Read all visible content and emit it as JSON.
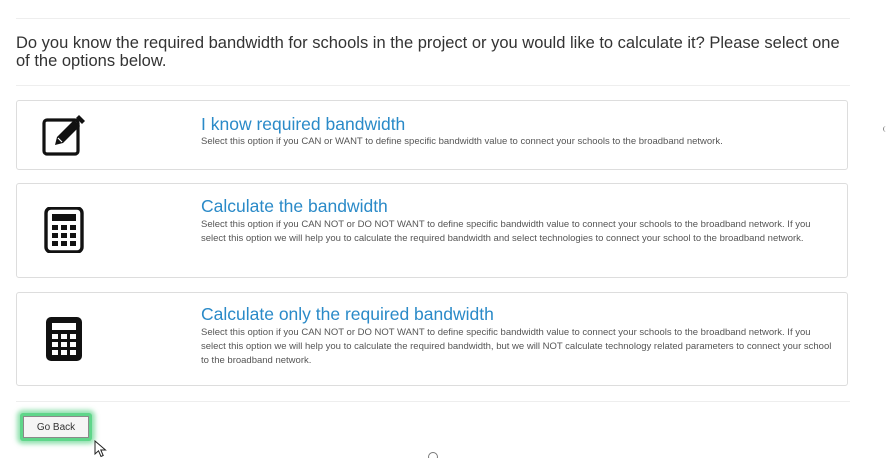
{
  "question": "Do you know the required bandwidth for schools in the project or you would like to calculate it? Please select one of the options below.",
  "options": [
    {
      "icon": "edit-icon",
      "title": "I know required bandwidth",
      "description": "Select this option if you CAN or WANT to define specific bandwidth value to connect your schools to the broadband network."
    },
    {
      "icon": "calculator-icon",
      "title": "Calculate the bandwidth",
      "description": "Select this option if you CAN NOT or DO NOT WANT to define specific bandwidth value to connect your schools to the broadband network. If you select this option we will help you to calculate the required bandwidth and select technologies to connect your school to the broadband network."
    },
    {
      "icon": "calculator-icon",
      "title": "Calculate only the required bandwidth",
      "description": "Select this option if you CAN NOT or DO NOT WANT to define specific bandwidth value to connect your schools to the broadband network. If you select this option we will help you to calculate the required bandwidth, but we will NOT calculate technology related parameters to connect your school to the broadband network."
    }
  ],
  "go_back_label": "Go Back",
  "colors": {
    "title_blue": "#2a8ac8",
    "highlight_green": "#5fd68a"
  }
}
